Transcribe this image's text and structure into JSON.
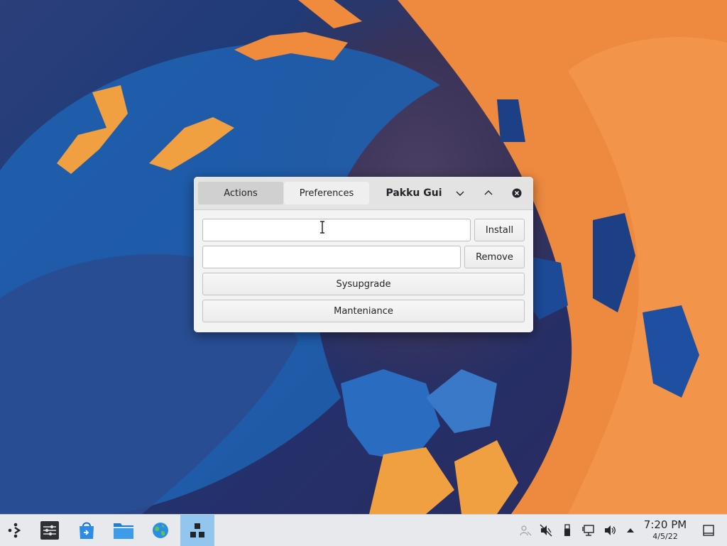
{
  "window": {
    "tabs": [
      {
        "label": "Actions",
        "active": true
      },
      {
        "label": "Preferences",
        "active": false
      }
    ],
    "title": "Pakku Gui",
    "controls": [
      "chevron-down-icon",
      "chevron-up-icon",
      "close-icon"
    ],
    "install_input": {
      "value": "",
      "placeholder": ""
    },
    "install_label": "Install",
    "remove_input": {
      "value": "",
      "placeholder": ""
    },
    "remove_label": "Remove",
    "sysupgrade_label": "Sysupgrade",
    "maintenance_label": "Manteniance"
  },
  "taskbar": {
    "launchers": [
      "app-launcher-icon",
      "system-settings-icon",
      "discover-store-icon",
      "file-manager-icon",
      "web-browser-icon",
      "pakku-gui-icon"
    ],
    "tray": [
      "user-icon",
      "muted-audio-icon",
      "usb-device-icon",
      "network-icon",
      "volume-icon",
      "expand-tray-icon"
    ],
    "clock": {
      "time": "7:20 PM",
      "date": "4/5/22"
    },
    "show_desktop": "show-desktop-icon"
  },
  "colors": {
    "accent": "#93c6ef",
    "wallpaper_blue": "#1d4f9e",
    "wallpaper_orange": "#f08a3c"
  }
}
